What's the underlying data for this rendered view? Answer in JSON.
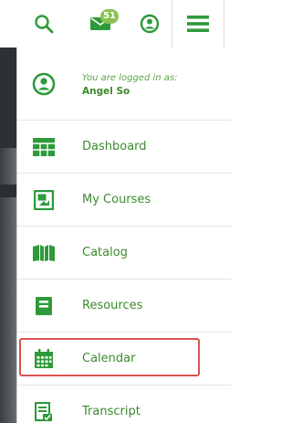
{
  "colors": {
    "accent": "#3c8a2e",
    "icon_green": "#2e9a3a",
    "badge": "#8cc152",
    "highlight": "#d9534f"
  },
  "toolbar": {
    "search_icon": "search-icon",
    "mail_icon": "envelope-icon",
    "mail_badge": "51",
    "user_icon": "user-circle-icon",
    "menu_icon": "hamburger-menu-icon"
  },
  "user": {
    "caption": "You are logged in as:",
    "name": "Angel So"
  },
  "menu": {
    "items": [
      {
        "label": "Dashboard",
        "icon": "dashboard-grid-icon"
      },
      {
        "label": "My Courses",
        "icon": "courses-icon"
      },
      {
        "label": "Catalog",
        "icon": "catalog-book-icon"
      },
      {
        "label": "Resources",
        "icon": "resources-notebook-icon"
      },
      {
        "label": "Calendar",
        "icon": "calendar-icon",
        "highlighted": true
      },
      {
        "label": "Transcript",
        "icon": "transcript-document-icon"
      }
    ]
  }
}
